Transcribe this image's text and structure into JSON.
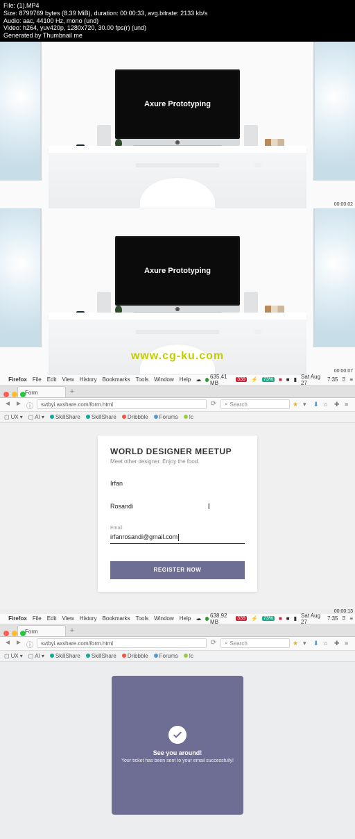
{
  "info": {
    "file": "File:  (1).MP4",
    "size": "Size: 8799769 bytes (8.39 MiB), duration: 00:00:33, avg.bitrate: 2133 kb/s",
    "audio": "Audio: aac, 44100 Hz, mono (und)",
    "video": "Video: h264, yuv420p, 1280x720, 30.00 fps(r) (und)",
    "generated": "Generated by Thumbnail me"
  },
  "monitor": {
    "title": "Axure Prototyping"
  },
  "timestamps": {
    "t1": "00:00:02",
    "t2": "00:00:07",
    "t3": "00:00:13"
  },
  "watermark": "www.cg-ku.com",
  "menubar": {
    "app": "Firefox",
    "items": [
      "File",
      "Edit",
      "View",
      "History",
      "Bookmarks",
      "Tools",
      "Window",
      "Help"
    ],
    "mem1": "635.41 MB",
    "mem2": "638.92 MB",
    "count": "339",
    "pct": "73%",
    "date": "Sat Aug 27",
    "time": "7:35"
  },
  "browser": {
    "tab": "Form",
    "url": "svtbyi.axshare.com/form.html",
    "search_placeholder": "Search",
    "bookmarks": {
      "b1": "UX",
      "b2": "AI",
      "b3": "SkillShare",
      "b4": "SkillShare",
      "b5": "Dribbble",
      "b6": "Forums",
      "b7": "Ic"
    }
  },
  "form": {
    "title": "WORLD DESIGNER MEETUP",
    "subtitle": "Meet other designer. Enjoy the food.",
    "first_name": "Irfan",
    "last_name": "Rosandi",
    "email_label": "Email",
    "email_value": "irfanrosandi@gmail.com",
    "button": "REGISTER NOW"
  },
  "success": {
    "title": "See you around!",
    "message": "Your ticket has been sent to your email successfully!"
  }
}
